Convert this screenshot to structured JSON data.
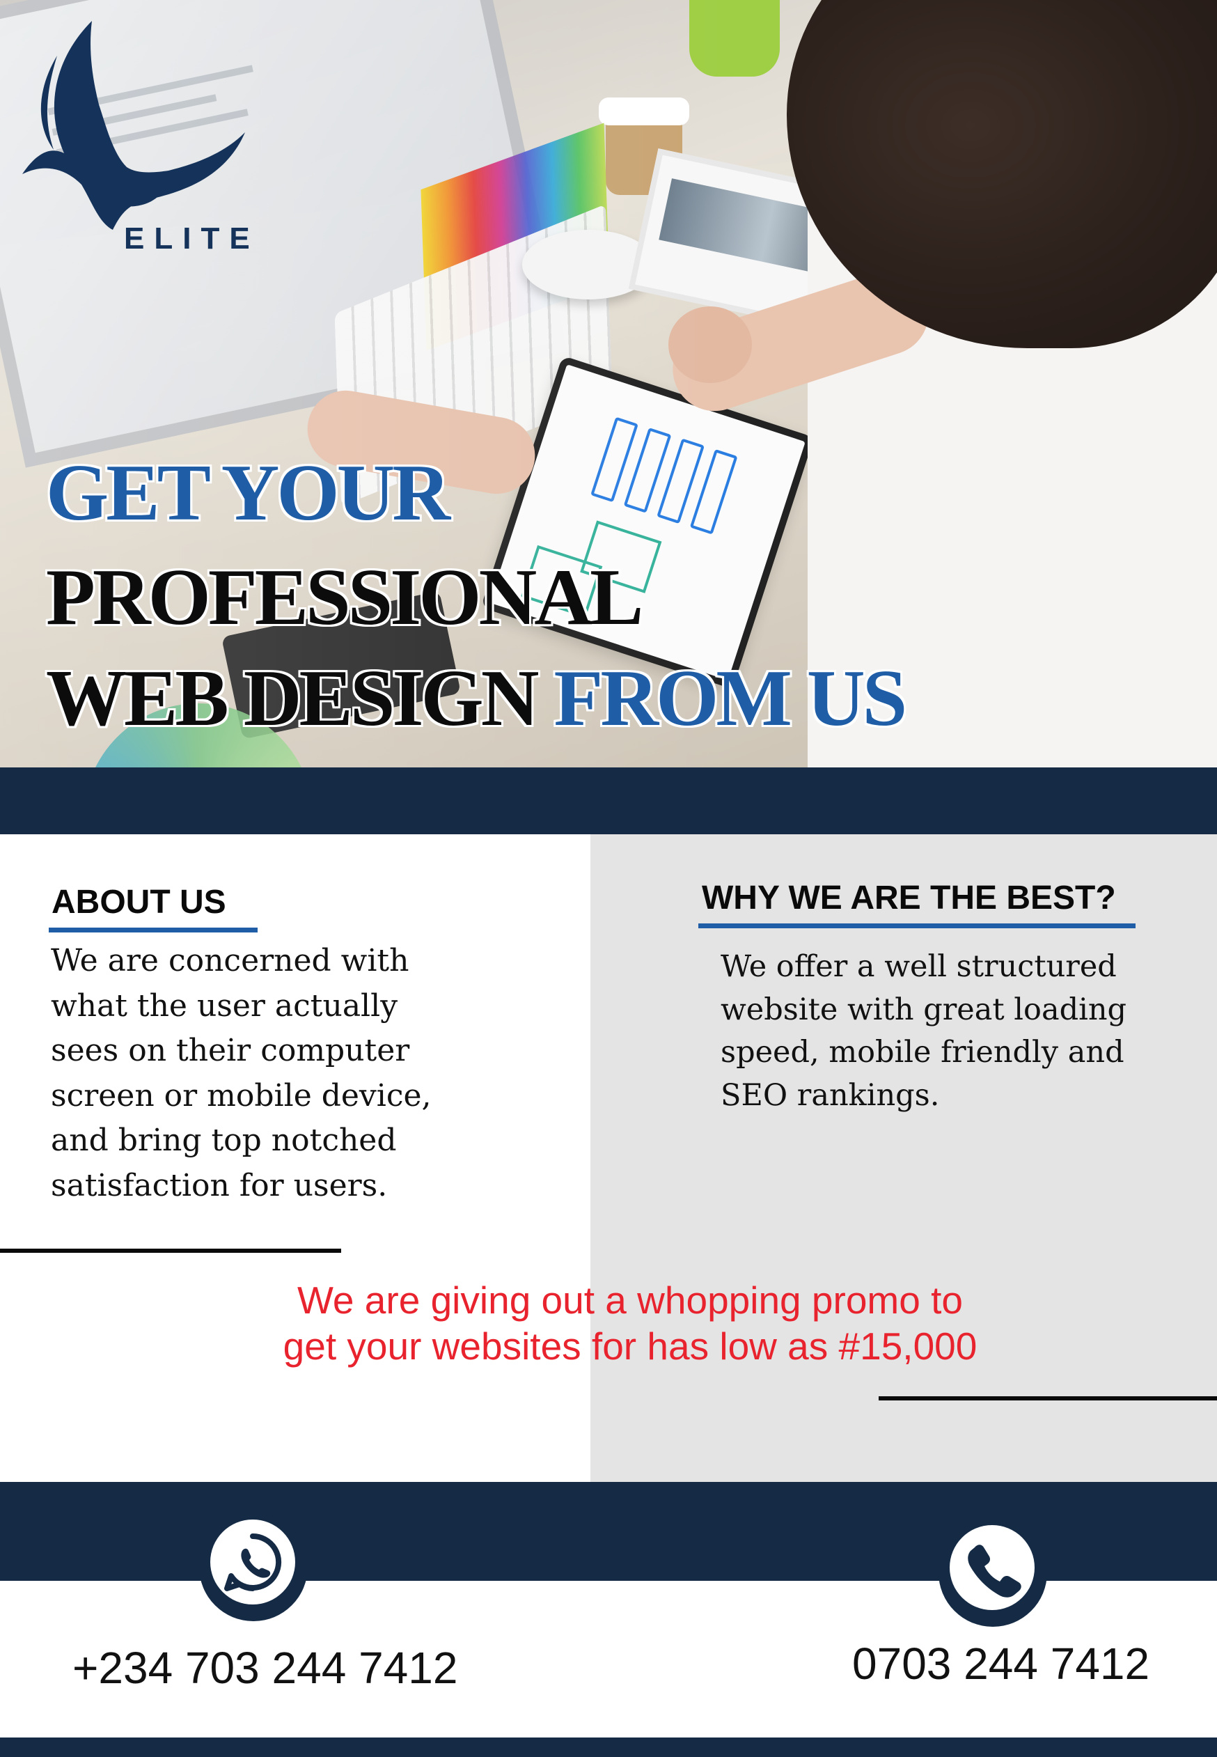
{
  "brand": {
    "name": "ELITE",
    "navy": "#152b45",
    "accent_blue": "#1f5ea6",
    "promo_red": "#e8232e"
  },
  "headline": {
    "line1": "GET YOUR",
    "line2": "PROFESSIONAL",
    "line3a": "WEB DESIGN",
    "line3b": "FROM US"
  },
  "about": {
    "title": "ABOUT US",
    "lines": [
      "We are concerned with",
      "what the user actually",
      "sees on their computer",
      "screen or mobile device,",
      "and bring top notched",
      "satisfaction for users."
    ]
  },
  "why": {
    "title": "WHY WE ARE THE BEST?",
    "lines": [
      "We offer a well structured",
      "website with great loading",
      "speed, mobile friendly and",
      "SEO rankings."
    ]
  },
  "promo": {
    "line1": "We are giving out a whopping promo to",
    "line2": "get your websites for has low as #15,000"
  },
  "contacts": {
    "whatsapp": {
      "icon": "whatsapp-icon",
      "number": "+234 703 244 7412"
    },
    "phone": {
      "icon": "phone-icon",
      "number": "0703 244 7412"
    }
  }
}
